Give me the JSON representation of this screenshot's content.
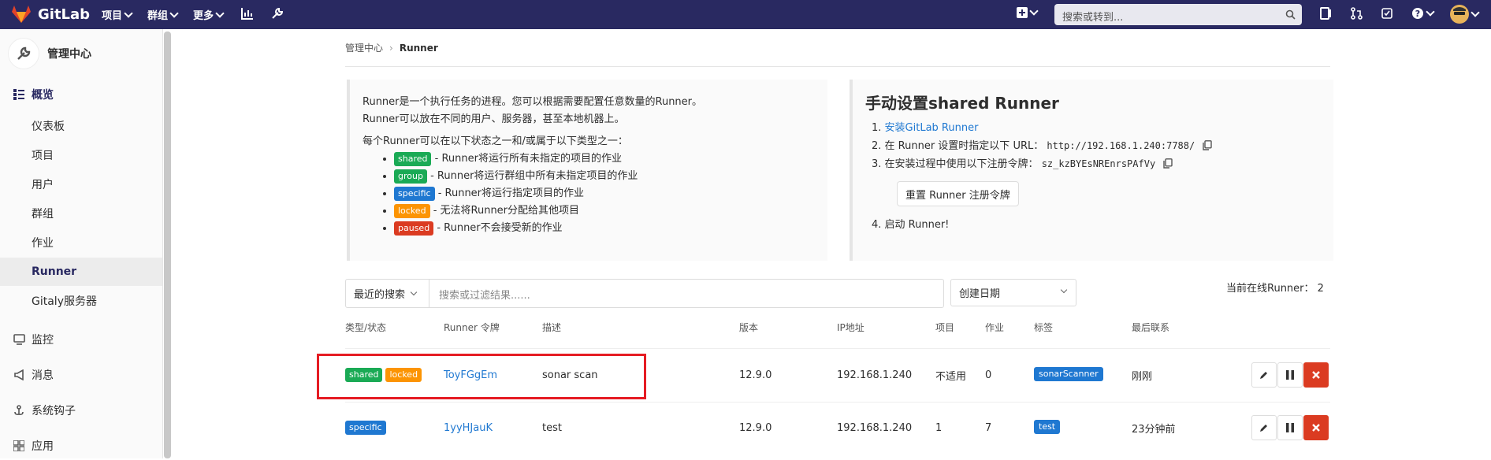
{
  "topbar": {
    "brand": "GitLab",
    "nav": [
      "项目",
      "群组",
      "更多"
    ],
    "search_placeholder": "搜索或转到..."
  },
  "sidebar": {
    "title": "管理中心",
    "overview": "概览",
    "sub_items": [
      "仪表板",
      "项目",
      "用户",
      "群组",
      "作业",
      "Runner",
      "Gitaly服务器"
    ],
    "sections": [
      "监控",
      "消息",
      "系统钩子",
      "应用"
    ]
  },
  "breadcrumb": [
    "管理中心",
    "Runner"
  ],
  "info": {
    "line1": "Runner是一个执行任务的进程。您可以根据需要配置任意数量的Runner。",
    "line2": "Runner可以放在不同的用户、服务器，甚至本地机器上。",
    "line3": "每个Runner可以在以下状态之一和/或属于以下类型之一：",
    "types": [
      {
        "badge": "shared",
        "text": " - Runner将运行所有未指定的项目的作业"
      },
      {
        "badge": "group",
        "text": " - Runner将运行群组中所有未指定项目的作业"
      },
      {
        "badge": "specific",
        "text": " - Runner将运行指定项目的作业"
      },
      {
        "badge": "locked",
        "text": " - 无法将Runner分配给其他项目"
      },
      {
        "badge": "paused",
        "text": " - Runner不会接受新的作业"
      }
    ]
  },
  "manual": {
    "title": "手动设置shared Runner",
    "step1_prefix": "1. ",
    "step1_link": "安装GitLab Runner",
    "step2_prefix": "2. 在 Runner 设置时指定以下 URL：",
    "step2_url": "http://192.168.1.240:7788/",
    "step3_prefix": "3. 在安装过程中使用以下注册令牌：",
    "step3_token": "sz_kzBYEsNREnrsPAfVy",
    "reset_button": "重置 Runner 注册令牌",
    "step4": "4. 启动 Runner!"
  },
  "filter": {
    "recent": "最近的搜索",
    "placeholder": "搜索或过滤结果......",
    "sort": "创建日期",
    "online": "当前在线Runner： 2"
  },
  "table": {
    "headers": [
      "类型/状态",
      "Runner 令牌",
      "描述",
      "版本",
      "IP地址",
      "项目",
      "作业",
      "标签",
      "最后联系"
    ],
    "rows": [
      {
        "badges": [
          "shared",
          "locked"
        ],
        "token": "ToyFGgEm",
        "desc": "sonar scan",
        "version": "12.9.0",
        "ip": "192.168.1.240",
        "projects": "不适用",
        "jobs": "0",
        "tag": "sonarScanner",
        "contact": "刚刚"
      },
      {
        "badges": [
          "specific"
        ],
        "token": "1yyHJauK",
        "desc": "test",
        "version": "12.9.0",
        "ip": "192.168.1.240",
        "projects": "1",
        "jobs": "7",
        "tag": "test",
        "contact": "23分钟前"
      }
    ]
  },
  "colors": {
    "topbar": "#292961",
    "shared": "#1aaa55",
    "specific": "#1f78d1",
    "locked": "#fc9403",
    "paused": "#db3b21",
    "highlight": "#e51c23"
  }
}
